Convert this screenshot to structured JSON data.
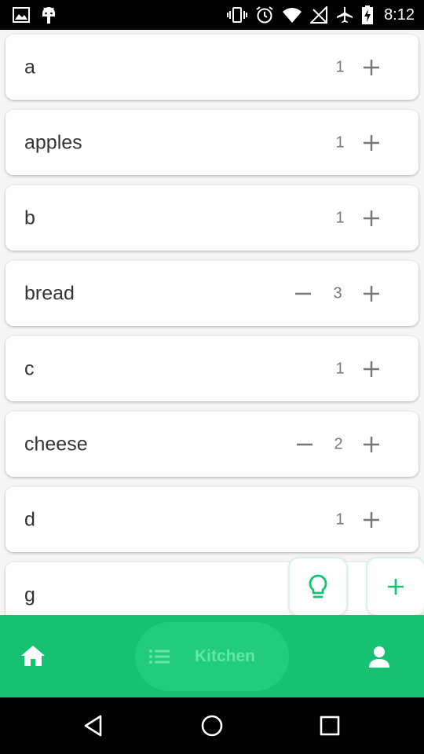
{
  "status_bar": {
    "time": "8:12",
    "left_icons": [
      "image-icon",
      "android-icon"
    ],
    "right_icons": [
      "vibrate-icon",
      "alarm-icon",
      "wifi-icon",
      "no-signal-icon",
      "airplane-icon",
      "battery-charging-icon"
    ]
  },
  "items": [
    {
      "name": "a",
      "qty": "1",
      "show_minus": false
    },
    {
      "name": "apples",
      "qty": "1",
      "show_minus": false
    },
    {
      "name": "b",
      "qty": "1",
      "show_minus": false
    },
    {
      "name": "bread",
      "qty": "3",
      "show_minus": true
    },
    {
      "name": "c",
      "qty": "1",
      "show_minus": false
    },
    {
      "name": "cheese",
      "qty": "2",
      "show_minus": true
    },
    {
      "name": "d",
      "qty": "1",
      "show_minus": false
    },
    {
      "name": "g",
      "qty": "",
      "show_minus": false
    }
  ],
  "fabs": {
    "suggest_icon": "lightbulb-icon",
    "add_icon": "plus-icon"
  },
  "bottom_nav": {
    "home_icon": "home-icon",
    "list_icon": "list-icon",
    "list_label": "Kitchen",
    "profile_icon": "person-icon"
  },
  "colors": {
    "accent": "#17c172",
    "pill": "#22cc7b",
    "pill_text": "#62e8a4"
  }
}
